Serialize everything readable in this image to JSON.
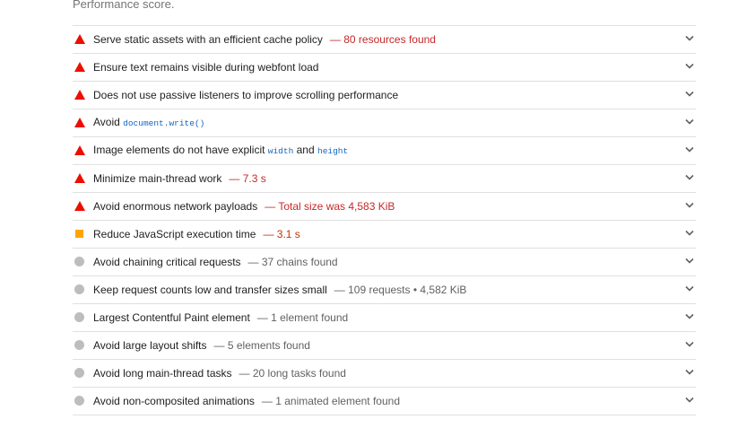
{
  "section": {
    "intro_text": "Performance score."
  },
  "audits": [
    {
      "status": "fail",
      "title": "Serve static assets with an efficient cache policy",
      "display": "— 80 resources found"
    },
    {
      "status": "fail",
      "title": "Ensure text remains visible during webfont load",
      "display": ""
    },
    {
      "status": "fail",
      "title": "Does not use passive listeners to improve scrolling performance",
      "display": ""
    },
    {
      "status": "fail",
      "title_before": "Avoid ",
      "code": "document.write()",
      "display": ""
    },
    {
      "status": "fail",
      "title_before": "Image elements do not have explicit ",
      "code": "width",
      "title_middle": " and ",
      "code2": "height",
      "display": ""
    },
    {
      "status": "fail",
      "title": "Minimize main-thread work",
      "display": "— 7.3 s"
    },
    {
      "status": "fail",
      "title": "Avoid enormous network payloads",
      "display": "— Total size was 4,583 KiB"
    },
    {
      "status": "average",
      "title": "Reduce JavaScript execution time",
      "display": "— 3.1 s"
    },
    {
      "status": "info",
      "title": "Avoid chaining critical requests",
      "display": "— 37 chains found"
    },
    {
      "status": "info",
      "title": "Keep request counts low and transfer sizes small",
      "display": "— 109 requests • 4,582 KiB"
    },
    {
      "status": "info",
      "title": "Largest Contentful Paint element",
      "display": "— 1 element found"
    },
    {
      "status": "info",
      "title": "Avoid large layout shifts",
      "display": "— 5 elements found"
    },
    {
      "status": "info",
      "title": "Avoid long main-thread tasks",
      "display": "— 20 long tasks found"
    },
    {
      "status": "info",
      "title": "Avoid non-composited animations",
      "display": "— 1 animated element found"
    }
  ],
  "icons": {
    "fail": "warning-triangle-icon",
    "average": "orange-square-icon",
    "info": "grey-circle-icon",
    "expand": "chevron-down-icon"
  },
  "colors": {
    "fail": "#eb0f00",
    "average": "#ffa400",
    "info": "#bdbdbd",
    "code": "#1565c0"
  }
}
